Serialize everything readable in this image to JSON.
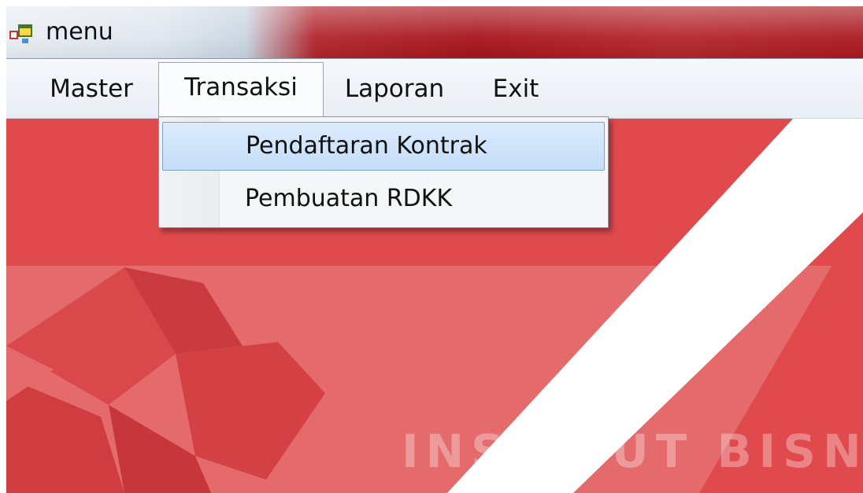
{
  "window": {
    "title": "menu",
    "icon": "app-form-icon"
  },
  "menubar": {
    "items": [
      {
        "label": "Master"
      },
      {
        "label": "Transaksi",
        "active": true
      },
      {
        "label": "Laporan"
      },
      {
        "label": "Exit"
      }
    ]
  },
  "dropdown": {
    "parent": "Transaksi",
    "items": [
      {
        "label": "Pendaftaran Kontrak",
        "highlighted": true
      },
      {
        "label": "Pembuatan RDKK"
      }
    ]
  },
  "background": {
    "watermark": "INSTITUT BISNIS",
    "colors": {
      "primary_red": "#e04a4d",
      "light_red": "#e56a6c",
      "stripe_white": "#ffffff"
    }
  },
  "colors": {
    "menu_highlight": "#c4def8",
    "menu_highlight_border": "#7da2ce",
    "titlebar_red": "#a7141c"
  }
}
